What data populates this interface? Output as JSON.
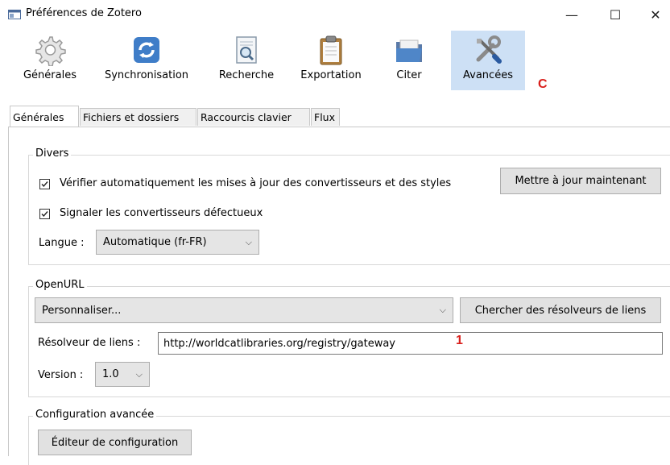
{
  "window": {
    "title": "Préférences de Zotero",
    "minimize": "—",
    "maximize": "☐",
    "close": "✕"
  },
  "toolbar": {
    "items": [
      {
        "label": "Générales",
        "icon": "gear-icon"
      },
      {
        "label": "Synchronisation",
        "icon": "sync-icon"
      },
      {
        "label": "Recherche",
        "icon": "search-document-icon"
      },
      {
        "label": "Exportation",
        "icon": "clipboard-icon"
      },
      {
        "label": "Citer",
        "icon": "folder-icon"
      },
      {
        "label": "Avancées",
        "icon": "tools-icon",
        "selected": true
      }
    ],
    "annotation": "C"
  },
  "tabs": [
    {
      "label": "Générales",
      "active": true
    },
    {
      "label": "Fichiers et dossiers"
    },
    {
      "label": "Raccourcis clavier"
    },
    {
      "label": "Flux"
    }
  ],
  "divers": {
    "legend": "Divers",
    "auto_update_label": "Vérifier automatiquement les mises à jour des convertisseurs et des styles",
    "auto_update_checked": true,
    "update_now_button": "Mettre à jour maintenant",
    "report_label": "Signaler les convertisseurs défectueux",
    "report_checked": true,
    "language_label": "Langue :",
    "language_value": "Automatique (fr-FR)"
  },
  "openurl": {
    "legend": "OpenURL",
    "resolver_select": "Personnaliser...",
    "find_resolvers_button": "Chercher des résolveurs de liens",
    "resolver_label": "Résolveur de liens :",
    "resolver_value": "http://worldcatlibraries.org/registry/gateway",
    "version_label": "Version :",
    "version_value": "1.0",
    "annotation": "1"
  },
  "advanced": {
    "legend": "Configuration avancée",
    "editor_button": "Éditeur de configuration"
  },
  "colors": {
    "selected_toolbar_bg": "#cde0f5",
    "annotation_red": "#d9201c"
  }
}
